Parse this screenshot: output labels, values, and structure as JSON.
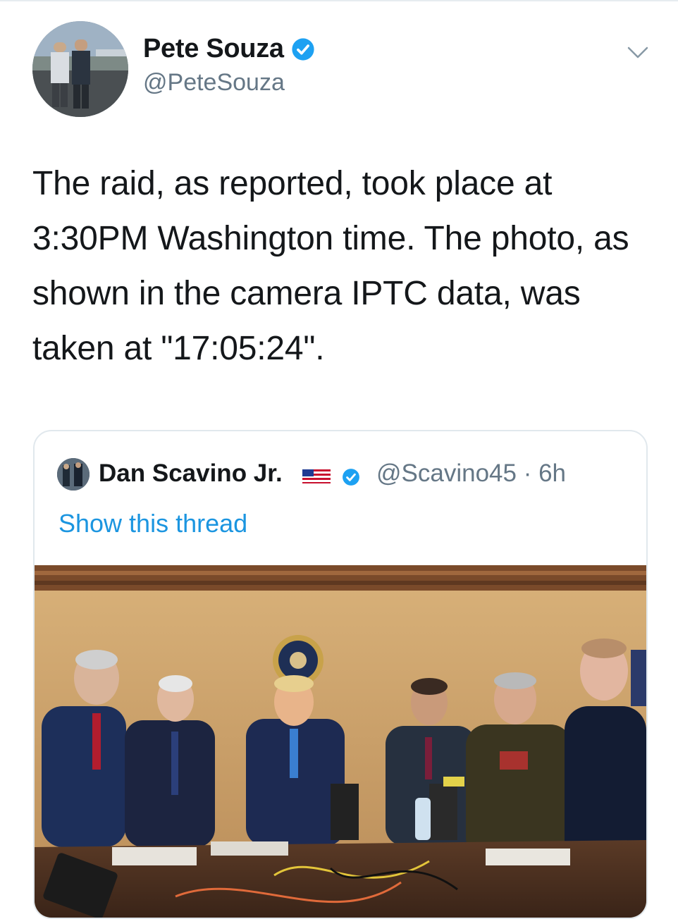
{
  "tweet": {
    "display_name": "Pete Souza",
    "handle": "@PeteSouza",
    "text": "The raid, as reported, took place at 3:30PM Washington time. The photo, as shown in the camera IPTC data, was taken at \"17:05:24\".",
    "icons": {
      "verified": "verified-badge-icon",
      "menu": "chevron-down-icon"
    },
    "colors": {
      "verified": "#1da1f2",
      "link": "#1b95e0",
      "secondary": "#657786"
    }
  },
  "quoted_tweet": {
    "display_name": "Dan Scavino Jr.",
    "handle_time": "@Scavino45 · 6h",
    "show_thread": "Show this thread",
    "icons": {
      "flag": "us-flag-icon",
      "verified": "verified-badge-icon"
    }
  }
}
